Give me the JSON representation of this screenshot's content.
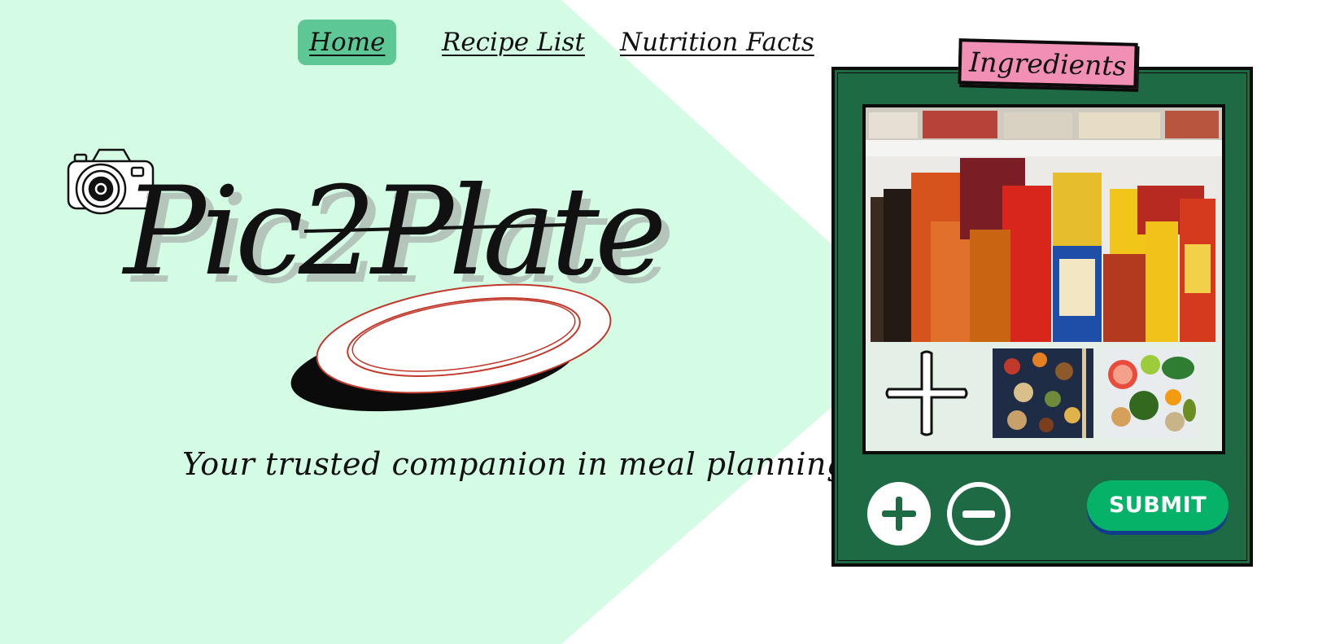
{
  "nav": {
    "items": [
      {
        "label": "Home",
        "active": true
      },
      {
        "label": "Recipe List",
        "active": false
      },
      {
        "label": "Nutrition Facts",
        "active": false
      }
    ]
  },
  "brand": {
    "logo_text": "Pic2Plate",
    "tagline": "Your trusted companion in meal planning"
  },
  "ingredients_panel": {
    "title": "Ingredients",
    "main_image": "pantry-shelf-photo",
    "thumbnails": [
      "add-image-icon",
      "spices-nuts-photo",
      "vegetables-fruits-photo"
    ],
    "add_button_icon": "plus-icon",
    "remove_button_icon": "minus-icon",
    "submit_label": "SUBMIT"
  },
  "colors": {
    "mint_background": "#d4fbe4",
    "active_nav": "#5ec796",
    "panel_green": "#1e6a45",
    "tab_pink": "#f28fb5",
    "submit_green": "#05b268",
    "submit_shadow": "#0f3d8a"
  }
}
